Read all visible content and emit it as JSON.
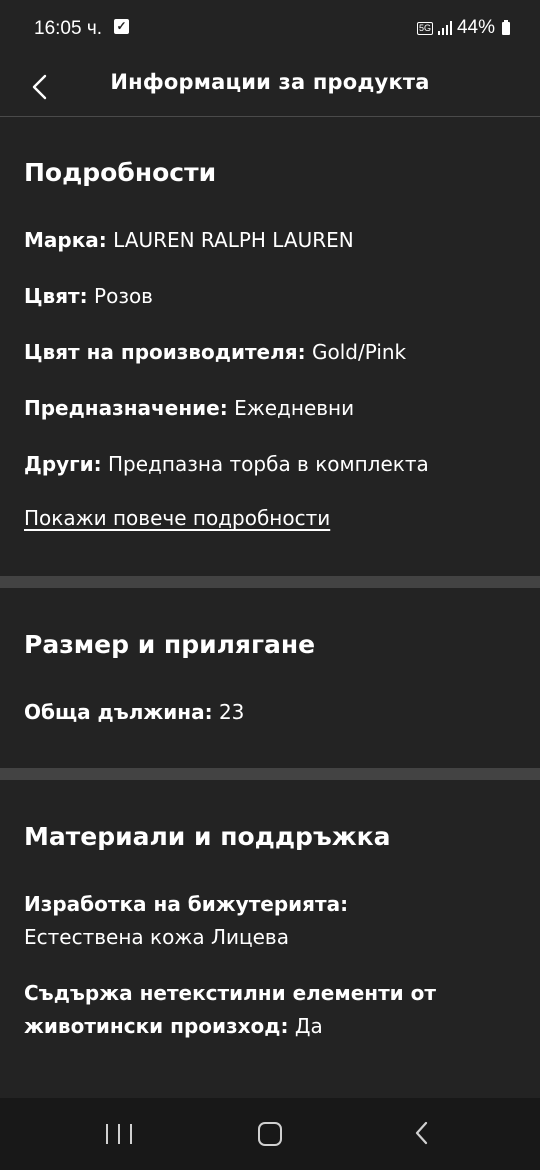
{
  "status_bar": {
    "time": "16:05 ч.",
    "network": "5G",
    "battery": "44%"
  },
  "header": {
    "title": "Информации за продукта"
  },
  "details": {
    "title": "Подробности",
    "rows": [
      {
        "label": "Марка:",
        "value": "LAUREN RALPH LAUREN"
      },
      {
        "label": "Цвят:",
        "value": "Розов"
      },
      {
        "label": "Цвят на производителя:",
        "value": "Gold/Pink"
      },
      {
        "label": "Предназначение:",
        "value": "Ежедневни"
      },
      {
        "label": "Други:",
        "value": "Предпазна торба в комплекта"
      }
    ],
    "more_link": "Покажи повече подробности"
  },
  "size_fit": {
    "title": "Размер и прилягане",
    "rows": [
      {
        "label": "Обща дължина:",
        "value": "23"
      }
    ]
  },
  "materials": {
    "title": "Материали и поддръжка",
    "rows": [
      {
        "label": "Изработка на бижутерията:",
        "value": "Естествена кожа Лицева"
      },
      {
        "label_line1": "Съдържа нетекстилни елементи от",
        "label_line2": "животински произход:",
        "value": "Да"
      }
    ]
  },
  "colors": {
    "background": "#232323",
    "divider": "#434343",
    "text": "#ffffff"
  }
}
